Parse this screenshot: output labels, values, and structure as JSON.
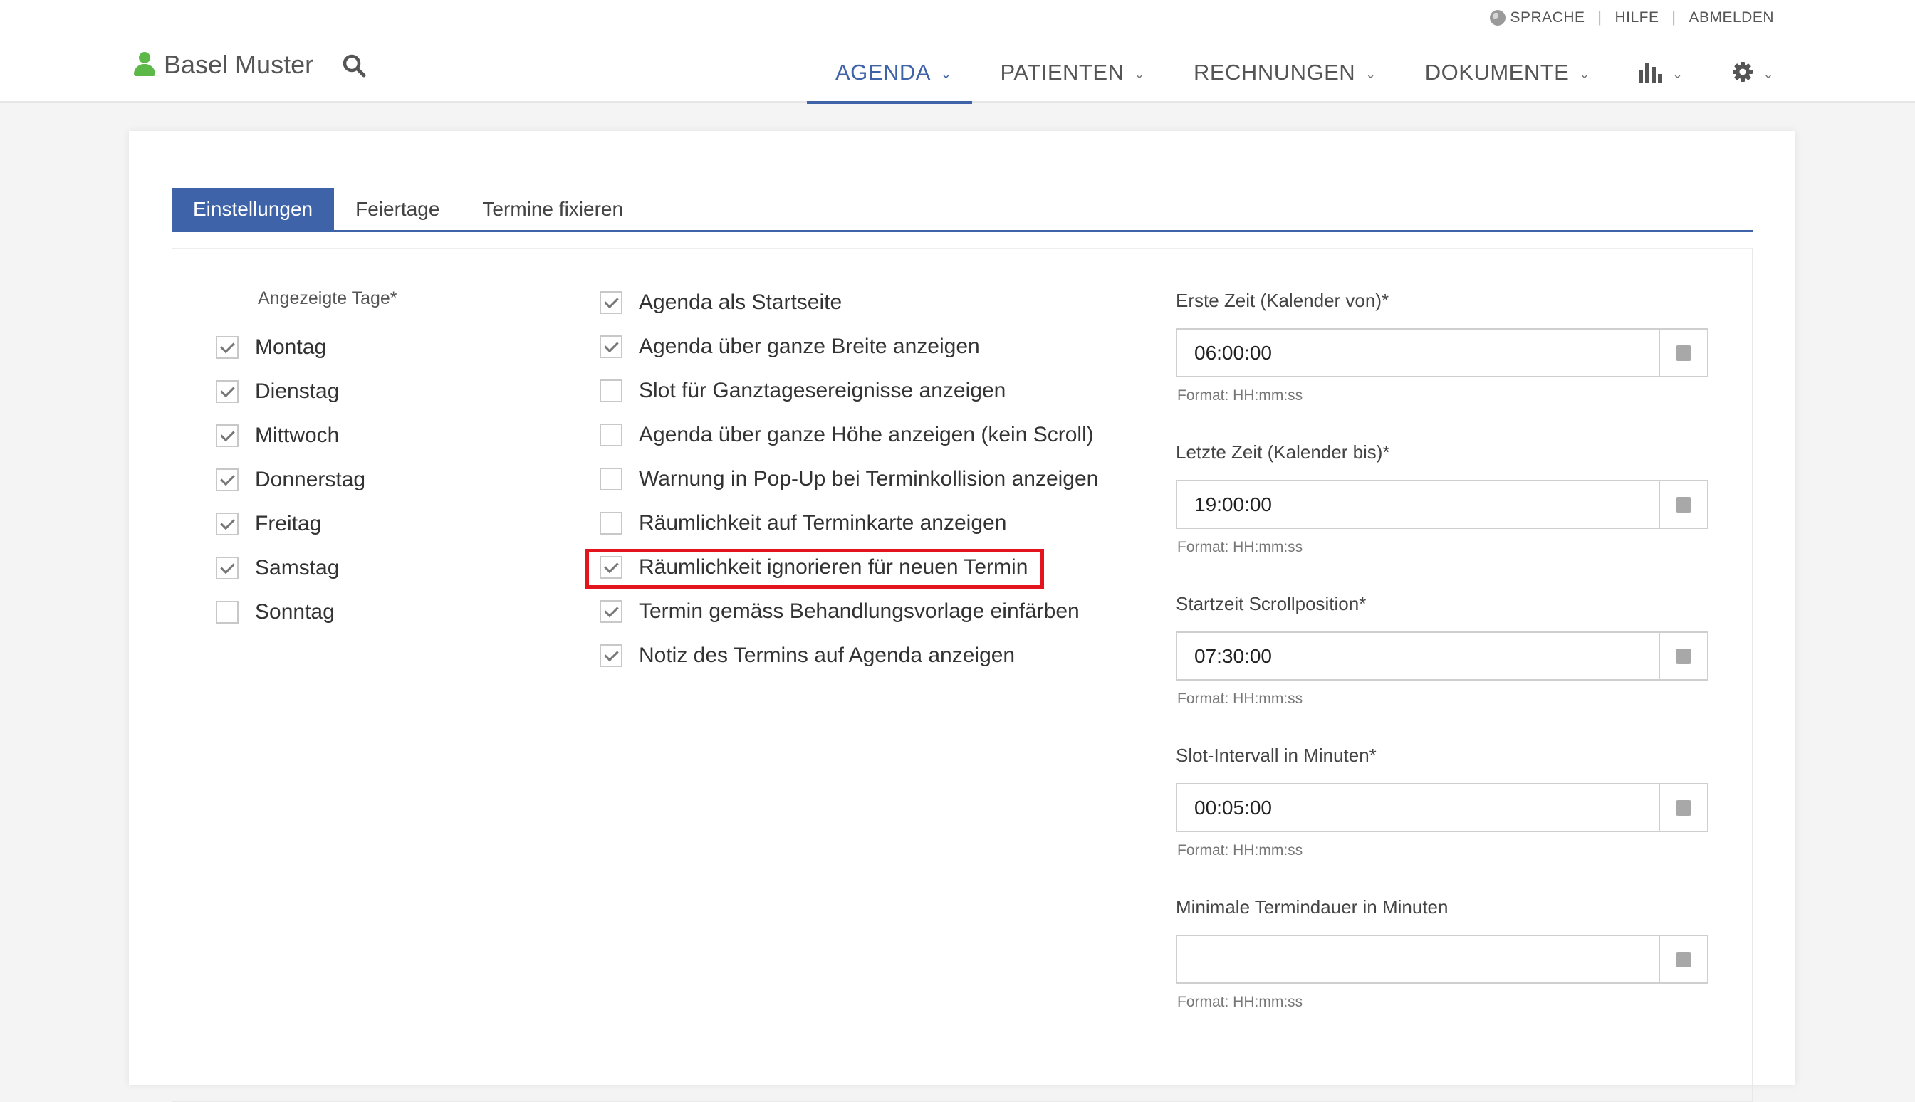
{
  "header": {
    "top_links": [
      {
        "label": "SPRACHE"
      },
      {
        "label": "HILFE"
      },
      {
        "label": "ABMELDEN"
      }
    ],
    "user_name": "Basel Muster",
    "nav": [
      {
        "label": "AGENDA"
      },
      {
        "label": "PATIENTEN"
      },
      {
        "label": "RECHNUNGEN"
      },
      {
        "label": "DOKUMENTE"
      }
    ]
  },
  "tabs": [
    {
      "label": "Einstellungen"
    },
    {
      "label": "Feiertage"
    },
    {
      "label": "Termine fixieren"
    }
  ],
  "days": {
    "label": "Angezeigte Tage*",
    "items": [
      {
        "label": "Montag",
        "checked": true
      },
      {
        "label": "Dienstag",
        "checked": true
      },
      {
        "label": "Mittwoch",
        "checked": true
      },
      {
        "label": "Donnerstag",
        "checked": true
      },
      {
        "label": "Freitag",
        "checked": true
      },
      {
        "label": "Samstag",
        "checked": true
      },
      {
        "label": "Sonntag",
        "checked": false
      }
    ]
  },
  "options": [
    {
      "label": "Agenda als Startseite",
      "checked": true
    },
    {
      "label": "Agenda über ganze Breite anzeigen",
      "checked": true
    },
    {
      "label": "Slot für Ganztagesereignisse anzeigen",
      "checked": false
    },
    {
      "label": "Agenda über ganze Höhe anzeigen (kein Scroll)",
      "checked": false
    },
    {
      "label": "Warnung in Pop-Up bei Terminkollision anzeigen",
      "checked": false
    },
    {
      "label": "Räumlichkeit auf Terminkarte anzeigen",
      "checked": false
    },
    {
      "label": "Räumlichkeit ignorieren für neuen Termin",
      "checked": true
    },
    {
      "label": "Termin gemäss Behandlungsvorlage einfärben",
      "checked": true
    },
    {
      "label": "Notiz des Termins auf Agenda anzeigen",
      "checked": true
    }
  ],
  "fields": [
    {
      "label": "Erste Zeit (Kalender von)*",
      "value": "06:00:00",
      "hint": "Format: HH:mm:ss"
    },
    {
      "label": "Letzte Zeit (Kalender bis)*",
      "value": "19:00:00",
      "hint": "Format: HH:mm:ss"
    },
    {
      "label": "Startzeit Scrollposition*",
      "value": "07:30:00",
      "hint": "Format: HH:mm:ss"
    },
    {
      "label": "Slot-Intervall in Minuten*",
      "value": "00:05:00",
      "hint": "Format: HH:mm:ss"
    },
    {
      "label": "Minimale Termindauer in Minuten",
      "value": "",
      "hint": "Format: HH:mm:ss"
    }
  ],
  "colors": {
    "accent": "#3f63a8",
    "user_icon": "#5cb847",
    "highlight_border": "#e3141d"
  }
}
